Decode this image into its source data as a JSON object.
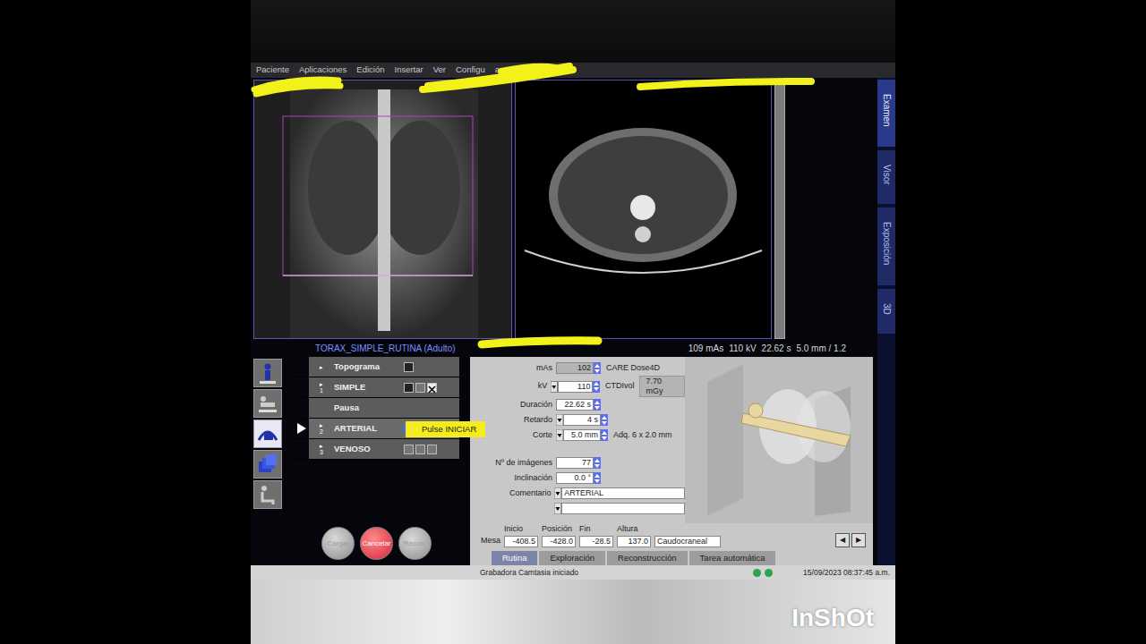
{
  "menu": [
    "Paciente",
    "Aplicaciones",
    "Edición",
    "Insertar",
    "Ver",
    "Configu",
    "ama",
    "Ayuda"
  ],
  "side_tabs": [
    {
      "label": "Examen",
      "selected": true
    },
    {
      "label": "Visor",
      "selected": false
    },
    {
      "label": "Exposición",
      "selected": false
    },
    {
      "label": "3D",
      "selected": false
    }
  ],
  "protocol": {
    "name": "TORAX_SIMPLE_RUTINA (Adulto)",
    "summary": [
      "109 mAs",
      "110 kV",
      "22.62 s",
      "5.0 mm / 1.2"
    ]
  },
  "tools": [
    {
      "selected": false
    },
    {
      "selected": false
    },
    {
      "selected": true
    },
    {
      "selected": false
    },
    {
      "selected": false
    }
  ],
  "steps": [
    {
      "arrow": "▸",
      "label": "Topograma",
      "selected": false,
      "boxes": [
        {
          "kind": "image"
        }
      ]
    },
    {
      "arrow": "▸",
      "number": "1",
      "label": "SIMPLE",
      "selected": false,
      "boxes": [
        {
          "kind": "image"
        },
        {
          "kind": "empty"
        },
        {
          "kind": "cross"
        }
      ]
    },
    {
      "label": "Pausa",
      "selected": false,
      "boxes": []
    },
    {
      "arrow": "▸",
      "number": "2",
      "label": "ARTERIAL",
      "selected": true,
      "boxes": [
        {
          "kind": "active"
        }
      ]
    },
    {
      "arrow": "▸",
      "number": "3",
      "label": "VENOSO",
      "selected": false,
      "boxes": [
        {
          "kind": "empty"
        },
        {
          "kind": "empty"
        },
        {
          "kind": "empty"
        }
      ]
    }
  ],
  "tooltip": "Pulse INICIAR",
  "actions": [
    {
      "label": "Cargar",
      "disabled": true
    },
    {
      "label": "Cancelar",
      "disabled": false
    },
    {
      "label": "Recon.",
      "disabled": true
    }
  ],
  "params": [
    {
      "label": "mAs",
      "value": "102",
      "kind": "readonly",
      "note": "CARE Dose4D"
    },
    {
      "label": "kV",
      "value": "110",
      "kind": "dropdown",
      "note": "CTDIvol",
      "note_value": "7.70 mGy"
    },
    {
      "label": "Duración",
      "value": "22.62 s",
      "kind": "spin"
    },
    {
      "label": "Retardo",
      "value": "4 s",
      "kind": "dropdown"
    },
    {
      "label": "Corte",
      "value": "5.0 mm",
      "kind": "dropdown",
      "note": "Adq. 6 x 2.0 mm"
    },
    {
      "label": "Nº de imágenes",
      "value": "77",
      "kind": "spin"
    },
    {
      "label": "Inclinación",
      "value": "0.0 °",
      "kind": "spin"
    },
    {
      "label": "Comentario",
      "value": "ARTERIAL",
      "kind": "text"
    }
  ],
  "table": {
    "row_label": "Mesa",
    "columns": [
      "Inicio",
      "Posición",
      "Fin",
      "Altura"
    ],
    "values": [
      "-408.5",
      "-428.0",
      "-28.5",
      "137.0"
    ],
    "direction": "Caudocraneal"
  },
  "nav": [
    "◀",
    "▶"
  ],
  "panel_tabs": [
    {
      "label": "Rutina",
      "selected": true
    },
    {
      "label": "Exploración",
      "selected": false
    },
    {
      "label": "Reconstrucción",
      "selected": false
    },
    {
      "label": "Tarea automática",
      "selected": false
    }
  ],
  "status": {
    "message": "Grabadora Camtasia iniciado",
    "datetime": "15/09/2023 08:37:45 a.m."
  },
  "watermark": "InShOt"
}
